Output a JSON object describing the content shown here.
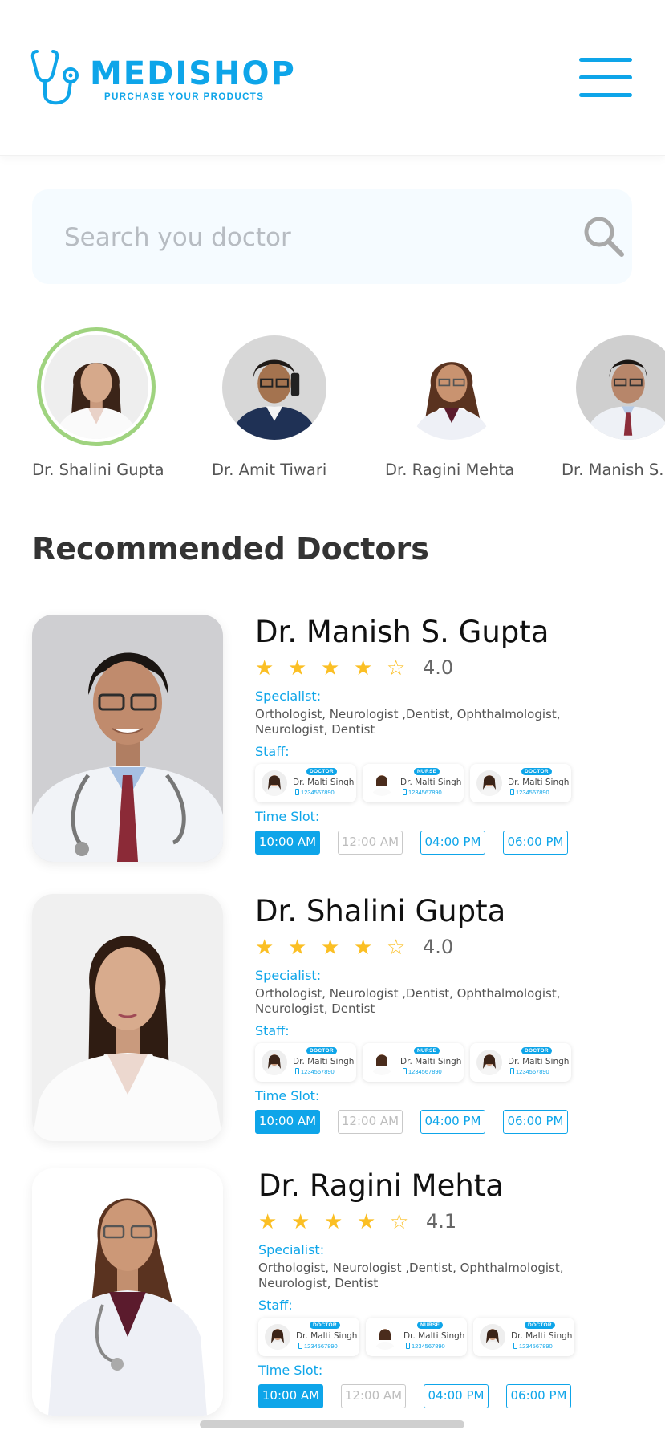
{
  "brand": {
    "name": "MEDISHOP",
    "tagline": "PURCHASE YOUR PRODUCTS",
    "accent": "#0ea5e9"
  },
  "search": {
    "placeholder": "Search you doctor",
    "value": ""
  },
  "doctor_strip": [
    {
      "name": "Dr. Shalini Gupta",
      "active": true
    },
    {
      "name": "Dr. Amit Tiwari",
      "active": false
    },
    {
      "name": "Dr. Ragini Mehta",
      "active": false
    },
    {
      "name": "Dr. Manish S.",
      "active": false
    }
  ],
  "section_title": "Recommended Doctors",
  "labels": {
    "specialist": "Specialist:",
    "staff": "Staff:",
    "time_slot": "Time Slot:"
  },
  "doctors": [
    {
      "name": "Dr. Manish S. Gupta",
      "stars": 4,
      "rating": "4.0",
      "specialist": "Orthologist, Neurologist ,Dentist, Ophthalmologist, Neurologist, Dentist",
      "staff": [
        {
          "role": "DOCTOR",
          "name": "Dr. Malti Singh",
          "phone": "1234567890"
        },
        {
          "role": "NURSE",
          "name": "Dr. Malti Singh",
          "phone": "1234567890"
        },
        {
          "role": "DOCTOR",
          "name": "Dr. Malti Singh",
          "phone": "1234567890"
        }
      ],
      "slots": [
        {
          "time": "10:00 AM",
          "state": "selected"
        },
        {
          "time": "12:00 AM",
          "state": "disabled"
        },
        {
          "time": "04:00 PM",
          "state": "available"
        },
        {
          "time": "06:00 PM",
          "state": "available"
        }
      ]
    },
    {
      "name": "Dr. Shalini Gupta",
      "stars": 4,
      "rating": "4.0",
      "specialist": "Orthologist, Neurologist ,Dentist, Ophthalmologist, Neurologist, Dentist",
      "staff": [
        {
          "role": "DOCTOR",
          "name": "Dr. Malti Singh",
          "phone": "1234567890"
        },
        {
          "role": "NURSE",
          "name": "Dr. Malti Singh",
          "phone": "1234567890"
        },
        {
          "role": "DOCTOR",
          "name": "Dr. Malti Singh",
          "phone": "1234567890"
        }
      ],
      "slots": [
        {
          "time": "10:00 AM",
          "state": "selected"
        },
        {
          "time": "12:00 AM",
          "state": "disabled"
        },
        {
          "time": "04:00 PM",
          "state": "available"
        },
        {
          "time": "06:00 PM",
          "state": "available"
        }
      ]
    },
    {
      "name": "Dr. Ragini Mehta",
      "stars": 4,
      "rating": "4.1",
      "specialist": "Orthologist, Neurologist ,Dentist, Ophthalmologist, Neurologist, Dentist",
      "staff": [
        {
          "role": "DOCTOR",
          "name": "Dr. Malti Singh",
          "phone": "1234567890"
        },
        {
          "role": "NURSE",
          "name": "Dr. Malti Singh",
          "phone": "1234567890"
        },
        {
          "role": "DOCTOR",
          "name": "Dr. Malti Singh",
          "phone": "1234567890"
        }
      ],
      "slots": [
        {
          "time": "10:00 AM",
          "state": "selected"
        },
        {
          "time": "12:00 AM",
          "state": "disabled"
        },
        {
          "time": "04:00 PM",
          "state": "available"
        },
        {
          "time": "06:00 PM",
          "state": "available"
        }
      ]
    }
  ]
}
